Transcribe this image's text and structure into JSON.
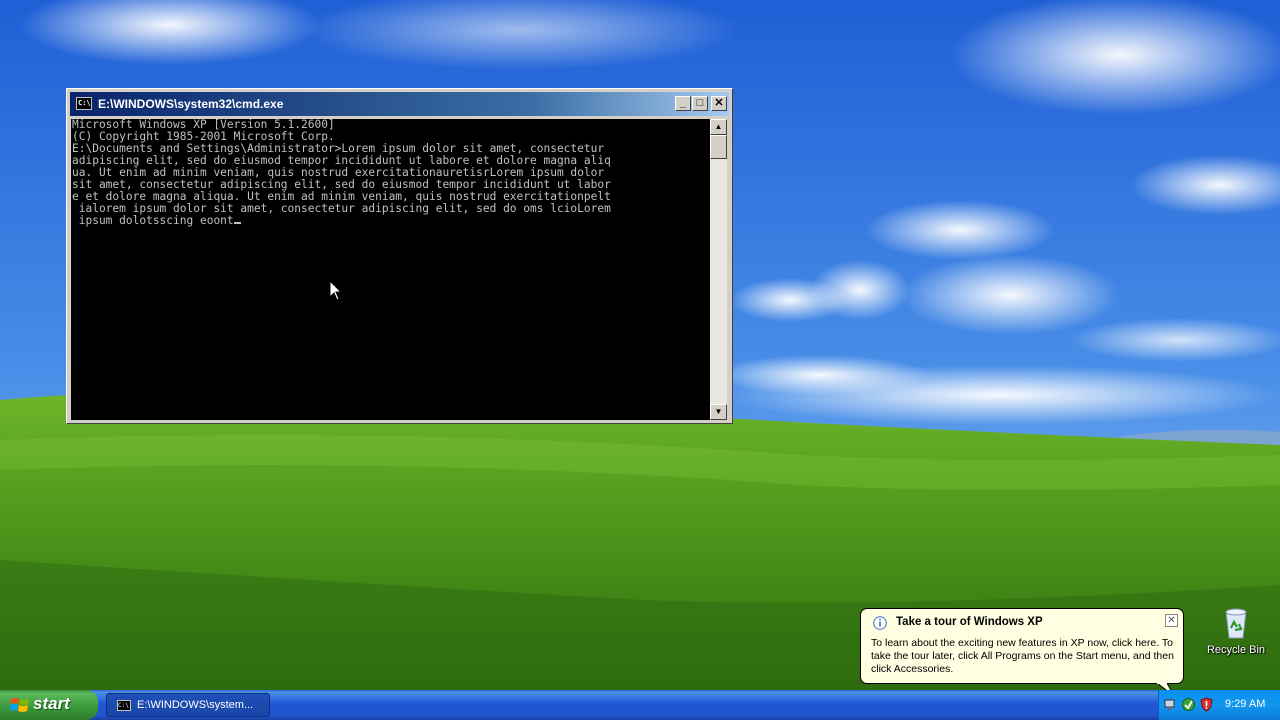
{
  "desktop": {
    "icons": [
      {
        "label": "Recycle Bin",
        "icon": "recycle-bin-icon"
      }
    ]
  },
  "cmd_window": {
    "title": "E:\\WINDOWS\\system32\\cmd.exe",
    "icon_text": "C:\\",
    "controls": {
      "minimize": "_",
      "maximize": "□",
      "close": "✕"
    },
    "console_lines": [
      "Microsoft Windows XP [Version 5.1.2600]",
      "(C) Copyright 1985-2001 Microsoft Corp.",
      "",
      "E:\\Documents and Settings\\Administrator>Lorem ipsum dolor sit amet, consectetur",
      "adipiscing elit, sed do eiusmod tempor incididunt ut labore et dolore magna aliq",
      "ua. Ut enim ad minim veniam, quis nostrud exercitationauretisrLorem ipsum dolor",
      "sit amet, consectetur adipiscing elit, sed do eiusmod tempor incididunt ut labor",
      "e et dolore magna aliqua. Ut enim ad minim veniam, quis nostrud exercitationpelt",
      " ialorem ipsum dolor sit amet, consectetur adipiscing elit, sed do oms lcioLorem",
      " ipsum dolotsscing eoont"
    ]
  },
  "balloon": {
    "title": "Take a tour of Windows XP",
    "body": "To learn about the exciting new features in XP now, click here. To take the tour later, click All Programs on the Start menu, and then click Accessories.",
    "close": "✕"
  },
  "taskbar": {
    "start_label": "start",
    "tasks": [
      {
        "label": "E:\\WINDOWS\\system...",
        "icon_text": "C:\\"
      }
    ],
    "tray": {
      "clock": "9:29 AM"
    }
  },
  "colors": {
    "console_bg": "#000000",
    "console_fg": "#c0c0c0",
    "taskbar_blue": "#2157d7",
    "start_green": "#3c9a3c",
    "balloon_bg": "#ffffe1"
  }
}
